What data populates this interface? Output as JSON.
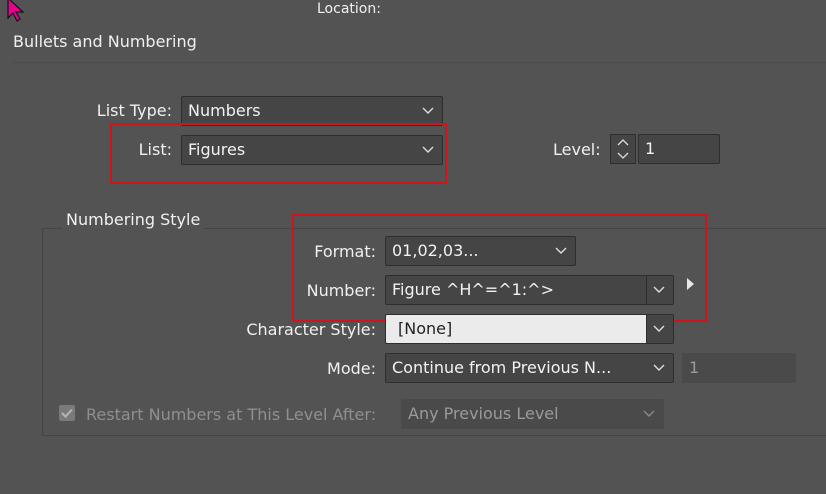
{
  "header": {
    "location_label": "Location:",
    "section_title": "Bullets and Numbering"
  },
  "list_type": {
    "label": "List Type:",
    "value": "Numbers"
  },
  "list": {
    "label": "List:",
    "value": "Figures"
  },
  "level": {
    "label": "Level:",
    "value": "1"
  },
  "numbering_style": {
    "legend": "Numbering Style",
    "format": {
      "label": "Format:",
      "value": "01,02,03..."
    },
    "number": {
      "label": "Number:",
      "value": "Figure ^H^=^1:^>"
    },
    "character_style": {
      "label": "Character Style:",
      "value": "[None]"
    },
    "mode": {
      "label": "Mode:",
      "value": "Continue from Previous N...",
      "start_value": "1"
    },
    "restart": {
      "label": "Restart Numbers at This Level After:",
      "value": "Any Previous Level",
      "checked": true
    }
  },
  "icons": [
    "cursor-arrow-icon",
    "chevron-down-icon",
    "stepper-arrows-icon",
    "triangle-right-icon",
    "checkmark-icon"
  ],
  "colors": {
    "background": "#535353",
    "highlight": "#d0141c",
    "field": "#454545"
  }
}
